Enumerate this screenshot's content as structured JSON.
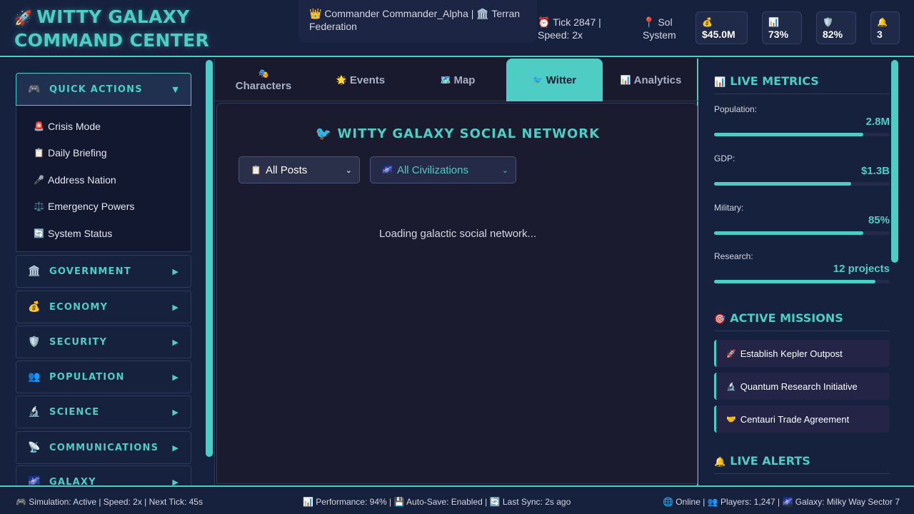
{
  "header": {
    "title": "WITTY GALAXY COMMAND CENTER",
    "commander": "👑 Commander Commander_Alpha | 🏛️ Terran Federation",
    "tick": "⏰ Tick 2847 | Speed: 2x",
    "system": "📍 Sol System",
    "stats": [
      {
        "icon": "💰",
        "value": "$45.0M"
      },
      {
        "icon": "📊",
        "value": "73%"
      },
      {
        "icon": "🛡️",
        "value": "82%"
      },
      {
        "icon": "🔔",
        "value": "3"
      }
    ]
  },
  "sidebar": {
    "sections": [
      {
        "icon": "🎮",
        "label": "QUICK ACTIONS",
        "open": true
      },
      {
        "icon": "🏛️",
        "label": "GOVERNMENT"
      },
      {
        "icon": "💰",
        "label": "ECONOMY"
      },
      {
        "icon": "🛡️",
        "label": "SECURITY"
      },
      {
        "icon": "👥",
        "label": "POPULATION"
      },
      {
        "icon": "🔬",
        "label": "SCIENCE"
      },
      {
        "icon": "📡",
        "label": "COMMUNICATIONS"
      },
      {
        "icon": "🌌",
        "label": "GALAXY"
      }
    ],
    "quick_actions": [
      {
        "icon": "🚨",
        "label": "Crisis Mode"
      },
      {
        "icon": "📋",
        "label": "Daily Briefing"
      },
      {
        "icon": "🎤",
        "label": "Address Nation"
      },
      {
        "icon": "⚖️",
        "label": "Emergency Powers"
      },
      {
        "icon": "🔄",
        "label": "System Status"
      }
    ]
  },
  "tabs": [
    {
      "icon": "🎭",
      "label": "Characters"
    },
    {
      "icon": "🌟",
      "label": "Events"
    },
    {
      "icon": "🗺️",
      "label": "Map"
    },
    {
      "icon": "🐦",
      "label": "Witter",
      "active": true
    },
    {
      "icon": "📊",
      "label": "Analytics"
    }
  ],
  "witter": {
    "title": "🐦 WITTY GALAXY SOCIAL NETWORK",
    "post_filter": {
      "icon": "📋",
      "selected": "All Posts"
    },
    "civ_filter": {
      "icon": "🌌",
      "selected": "All Civilizations"
    },
    "loading": "Loading galactic social network..."
  },
  "live_metrics": {
    "icon": "📊",
    "title": "LIVE METRICS",
    "items": [
      {
        "label": "Population:",
        "value": "2.8M",
        "fill": 0.85
      },
      {
        "label": "GDP:",
        "value": "$1.3B",
        "fill": 0.78
      },
      {
        "label": "Military:",
        "value": "85%",
        "fill": 0.85
      },
      {
        "label": "Research:",
        "value": "12 projects",
        "fill": 0.92
      }
    ]
  },
  "active_missions": {
    "icon": "🎯",
    "title": "ACTIVE MISSIONS",
    "items": [
      {
        "icon": "🚀",
        "label": "Establish Kepler Outpost"
      },
      {
        "icon": "🔬",
        "label": "Quantum Research Initiative"
      },
      {
        "icon": "🤝",
        "label": "Centauri Trade Agreement"
      }
    ]
  },
  "live_alerts": {
    "icon": "🔔",
    "title": "LIVE ALERTS"
  },
  "footer": {
    "left": "🎮 Simulation: Active | Speed: 2x | Next Tick: 45s",
    "center": "📊 Performance: 94% | 💾 Auto-Save: Enabled | 🔄 Last Sync: 2s ago",
    "right": "🌐 Online | 👥 Players: 1,247 | 🌌 Galaxy: Milky Way Sector 7"
  },
  "colors": {
    "accent": "#4ecdc4",
    "background": "#1a1a2e",
    "panel": "#16213e"
  }
}
